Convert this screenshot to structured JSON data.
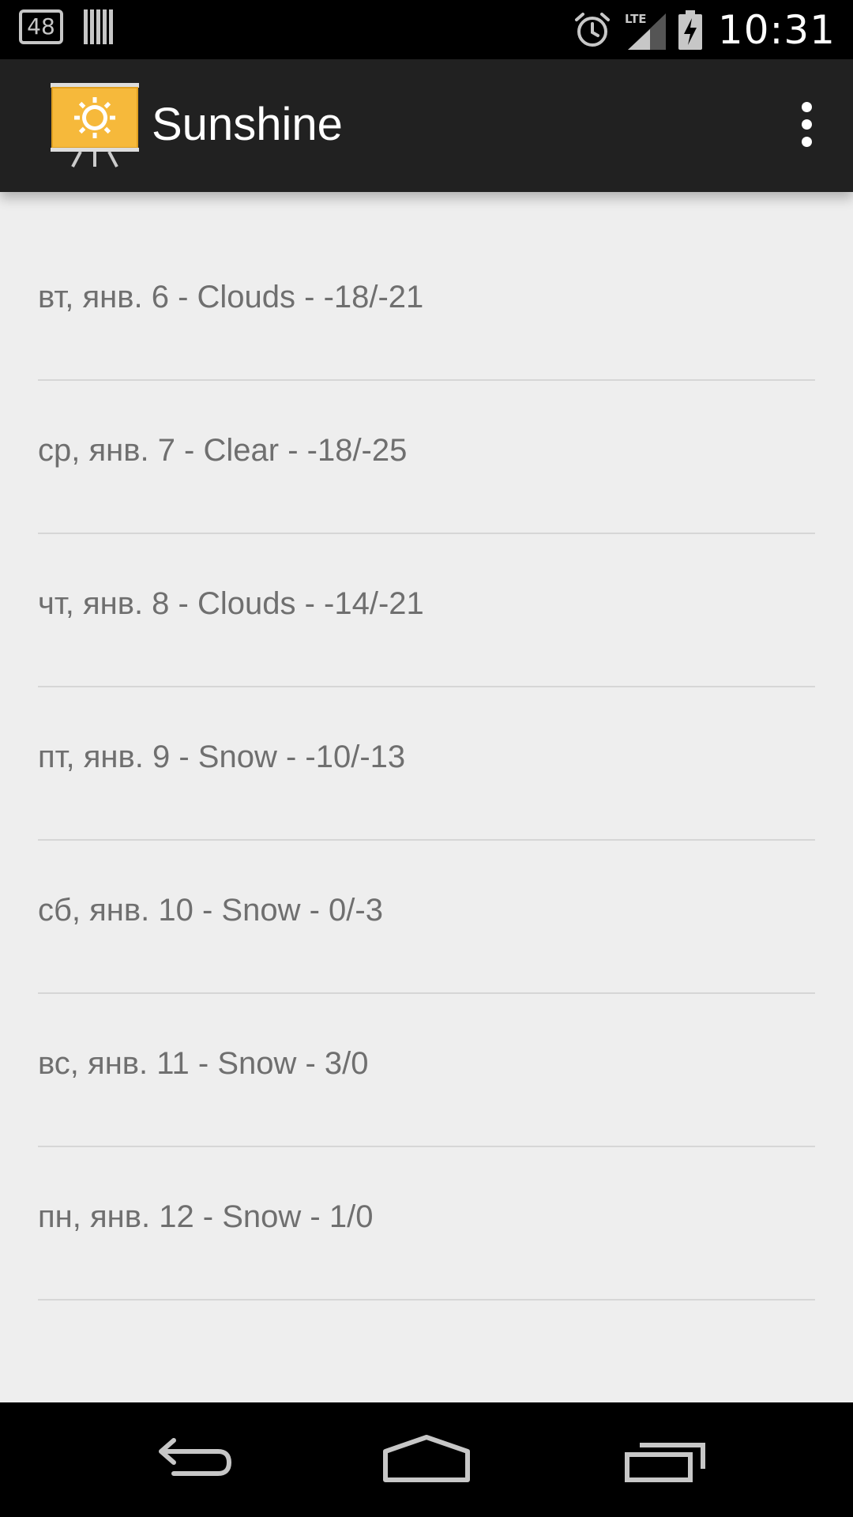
{
  "status_bar": {
    "notification_count": "48",
    "time": "10:31",
    "network": "LTE",
    "icons": [
      "notification-48-icon",
      "barcode-icon",
      "alarm-icon",
      "lte-signal-icon",
      "battery-charging-icon"
    ]
  },
  "action_bar": {
    "title": "Sunshine",
    "logo_icon": "sunshine-logo-icon",
    "overflow_icon": "overflow-menu-icon"
  },
  "forecast": [
    {
      "label": "вт, янв. 6 - Clouds - -18/-21"
    },
    {
      "label": "ср, янв. 7 - Clear - -18/-25"
    },
    {
      "label": "чт, янв. 8 - Clouds - -14/-21"
    },
    {
      "label": "пт, янв. 9 - Snow - -10/-13"
    },
    {
      "label": "сб, янв. 10 - Snow - 0/-3"
    },
    {
      "label": "вс, янв. 11 - Snow - 3/0"
    },
    {
      "label": "пн, янв. 12 - Snow - 1/0"
    }
  ],
  "nav_bar": {
    "icons": [
      "back-icon",
      "home-icon",
      "recents-icon"
    ]
  },
  "colors": {
    "status_bar": "#000000",
    "action_bar": "#212121",
    "background": "#eeeeee",
    "list_text": "#6f6f6f",
    "divider": "#d6d6d6",
    "logo_accent": "#f6b93b"
  }
}
